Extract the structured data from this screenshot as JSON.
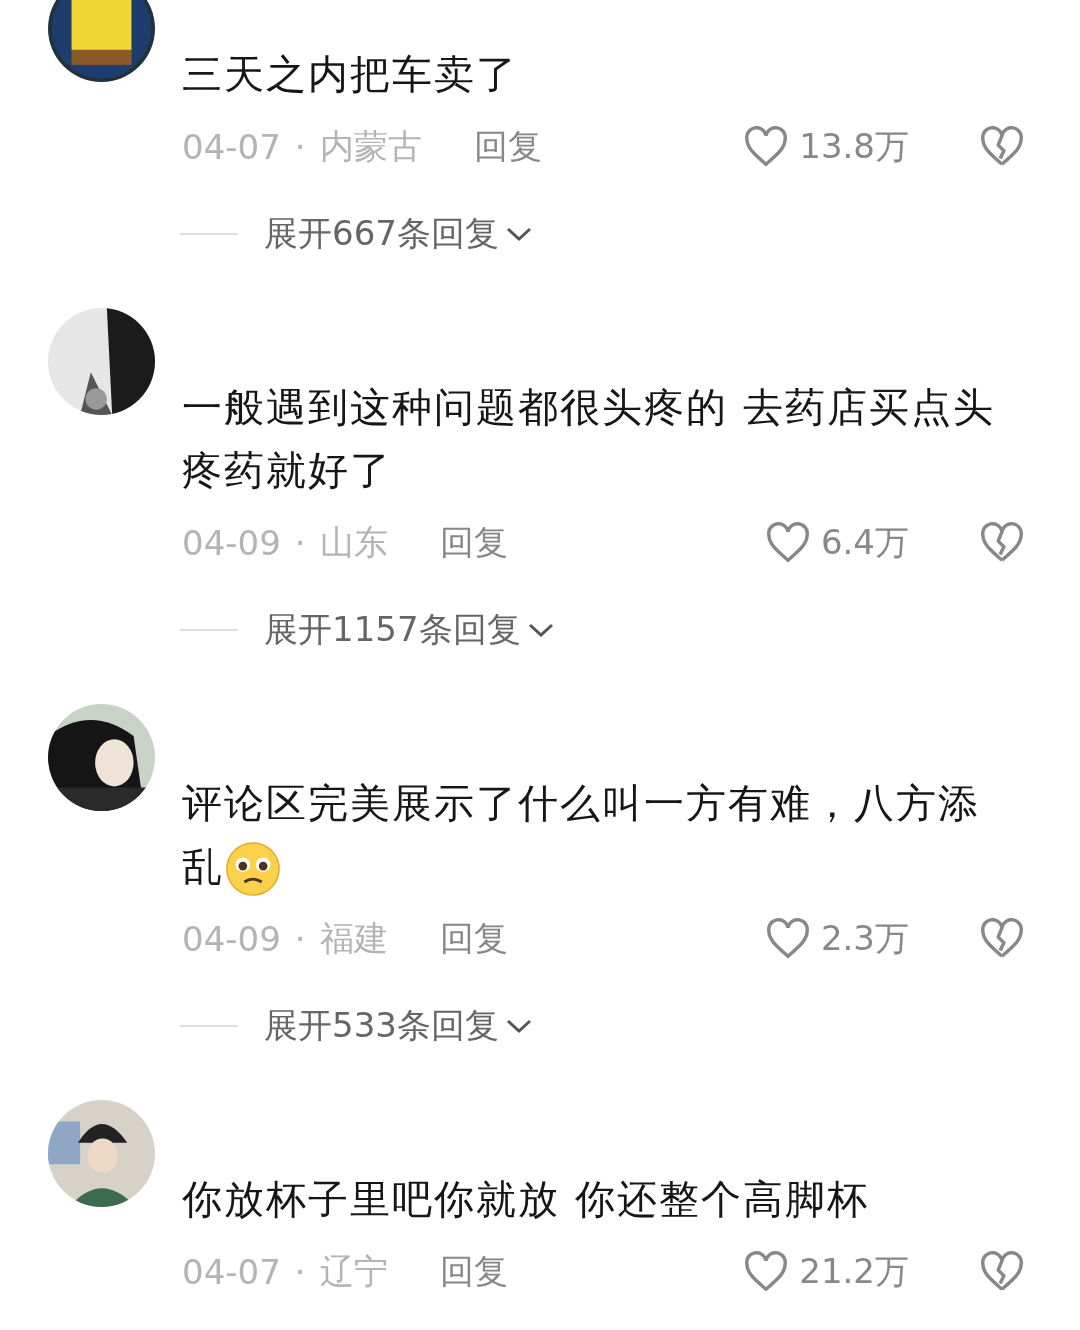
{
  "comments": [
    {
      "text": "三天之内把车卖了",
      "emoji": false,
      "date": "04-07",
      "separator": "·",
      "location": "内蒙古",
      "reply": "回复",
      "likes": "13.8万",
      "expand": "展开667条回复"
    },
    {
      "text": "一般遇到这种问题都很头疼的 去药店买点头疼药就好了",
      "emoji": false,
      "date": "04-09",
      "separator": "·",
      "location": "山东",
      "reply": "回复",
      "likes": "6.4万",
      "expand": "展开1157条回复"
    },
    {
      "text": "评论区完美展示了什么叫一方有难，八方添乱",
      "emoji": true,
      "date": "04-09",
      "separator": "·",
      "location": "福建",
      "reply": "回复",
      "likes": "2.3万",
      "expand": "展开533条回复"
    },
    {
      "text": "你放杯子里吧你就放 你还整个高脚杯",
      "emoji": false,
      "date": "04-07",
      "separator": "·",
      "location": "辽宁",
      "reply": "回复",
      "likes": "21.2万"
    }
  ]
}
